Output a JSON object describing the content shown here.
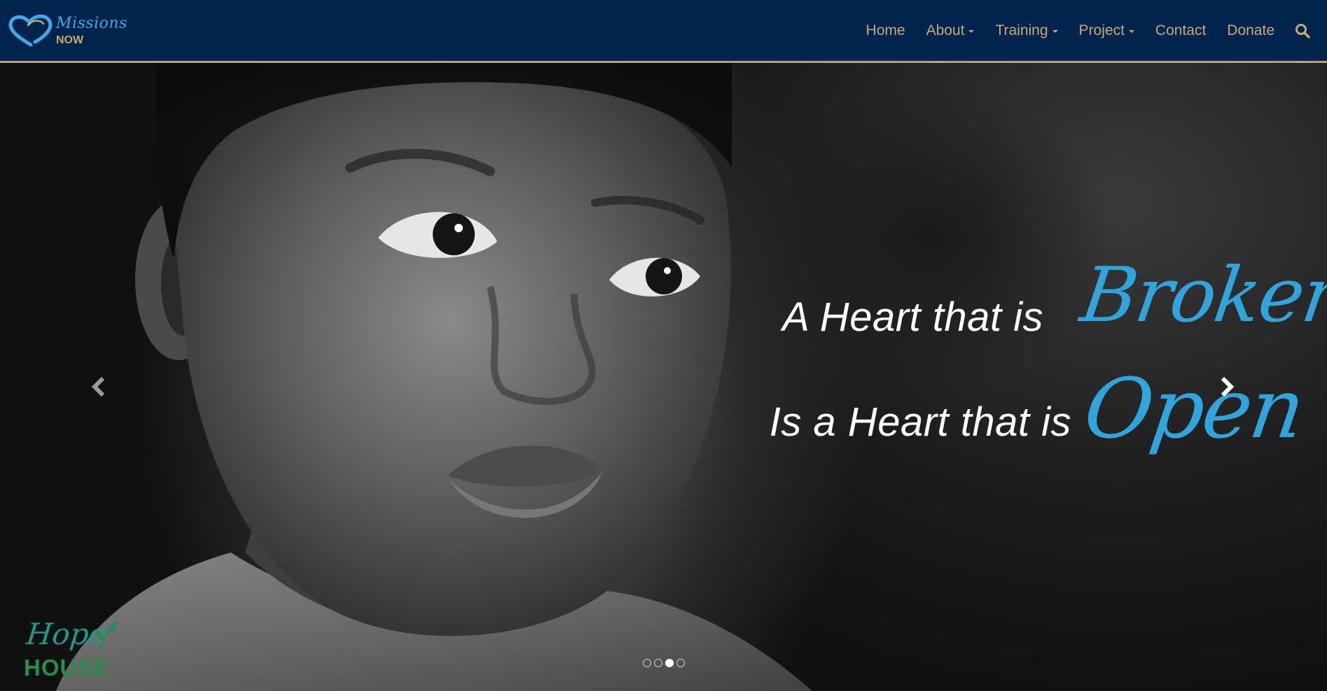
{
  "brand": {
    "script_text": "Missions",
    "word_text": "NOW",
    "heart_color": "#3fa9e0",
    "accent_color": "#c7aa72"
  },
  "nav": {
    "items": [
      {
        "label": "Home",
        "has_dropdown": false
      },
      {
        "label": "About",
        "has_dropdown": true
      },
      {
        "label": "Training",
        "has_dropdown": true
      },
      {
        "label": "Project",
        "has_dropdown": true
      },
      {
        "label": "Contact",
        "has_dropdown": false
      },
      {
        "label": "Donate",
        "has_dropdown": false
      }
    ],
    "search_icon": "search-icon",
    "background_color": "#03244f",
    "text_color": "#c7aa72"
  },
  "hero": {
    "line_1_text": "A Heart that is",
    "line_1_word": "Broken",
    "line_2_text": "Is a Heart that is",
    "line_2_word": "Open",
    "highlight_color": "#32a4dc",
    "prev_icon": "chevron-left-icon",
    "next_icon": "chevron-right-icon",
    "slides_count": 4,
    "active_slide_index": 2
  },
  "partner_logo": {
    "script_text": "Hope",
    "word_text": "HOUSE"
  }
}
